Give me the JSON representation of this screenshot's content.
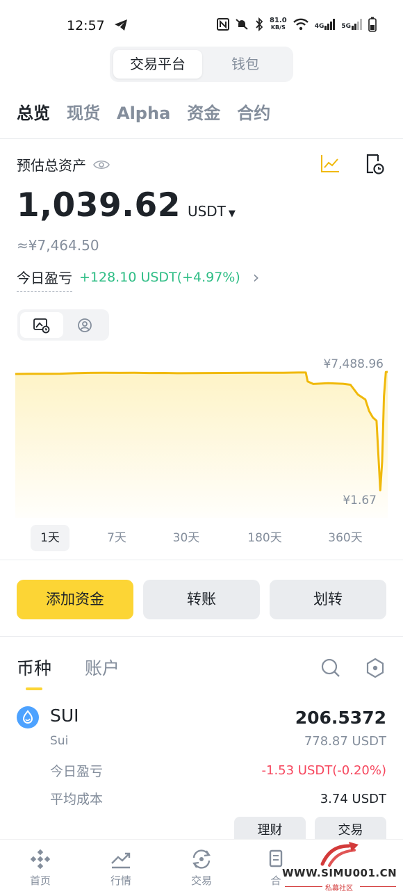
{
  "status": {
    "time": "12:57",
    "speed_top": "81.0",
    "speed_bottom": "KB/S",
    "net1": "4G",
    "net2": "5G"
  },
  "segment": {
    "active": "交易平台",
    "inactive": "钱包"
  },
  "main_tabs": [
    "总览",
    "现货",
    "Alpha",
    "资金",
    "合约"
  ],
  "overview": {
    "label": "预估总资产",
    "value": "1,039.62",
    "unit": "USDT",
    "cny": "≈¥7,464.50",
    "pnl_label": "今日盈亏",
    "pnl_value": "+128.10 USDT(+4.97%)"
  },
  "chart_data": {
    "type": "line",
    "title": "",
    "xlabel": "",
    "ylabel": "",
    "max_label": "¥7,488.96",
    "min_label": "¥1.67",
    "ylim": [
      1.67,
      7488.96
    ],
    "x": [
      0,
      4,
      8,
      12,
      16,
      20,
      24,
      28,
      32,
      36,
      40,
      44,
      48,
      52,
      56,
      60,
      64,
      68,
      72,
      76,
      78,
      78.5,
      80,
      84,
      88,
      90,
      92,
      94,
      95,
      96,
      97,
      98,
      98.5,
      99,
      99.5,
      100
    ],
    "values": [
      7360,
      7375,
      7375,
      7380,
      7410,
      7430,
      7440,
      7430,
      7435,
      7420,
      7425,
      7410,
      7412,
      7420,
      7425,
      7428,
      7440,
      7440,
      7440,
      7450,
      7450,
      6900,
      6750,
      6800,
      6760,
      6700,
      6100,
      5800,
      5100,
      4700,
      4500,
      250,
      2000,
      6000,
      7480,
      7489
    ],
    "line_color": "#f0b90b",
    "grid": false,
    "legend": "none"
  },
  "ranges": [
    "1天",
    "7天",
    "30天",
    "180天",
    "360天"
  ],
  "actions": {
    "deposit": "添加资金",
    "transfer": "转账",
    "move": "划转"
  },
  "list_tabs": {
    "active": "币种",
    "inactive": "账户"
  },
  "coin": {
    "symbol": "SUI",
    "name": "Sui",
    "amount": "206.5372",
    "usdt": "778.87 USDT",
    "pnl_label": "今日盈亏",
    "pnl_value": "-1.53 USDT(-0.20%)",
    "cost_label": "平均成本",
    "cost_value": "3.74 USDT",
    "btn1": "理财",
    "btn2": "交易"
  },
  "nav": {
    "home": "首页",
    "market": "行情",
    "trade": "交易",
    "futures": "合"
  },
  "watermark": {
    "text": "WWW.SIMU001.CN",
    "sub": "私募社区"
  },
  "colors": {
    "accent": "#fcd535",
    "up": "#2ebd85",
    "down": "#f6465d",
    "muted": "#848e9c"
  }
}
